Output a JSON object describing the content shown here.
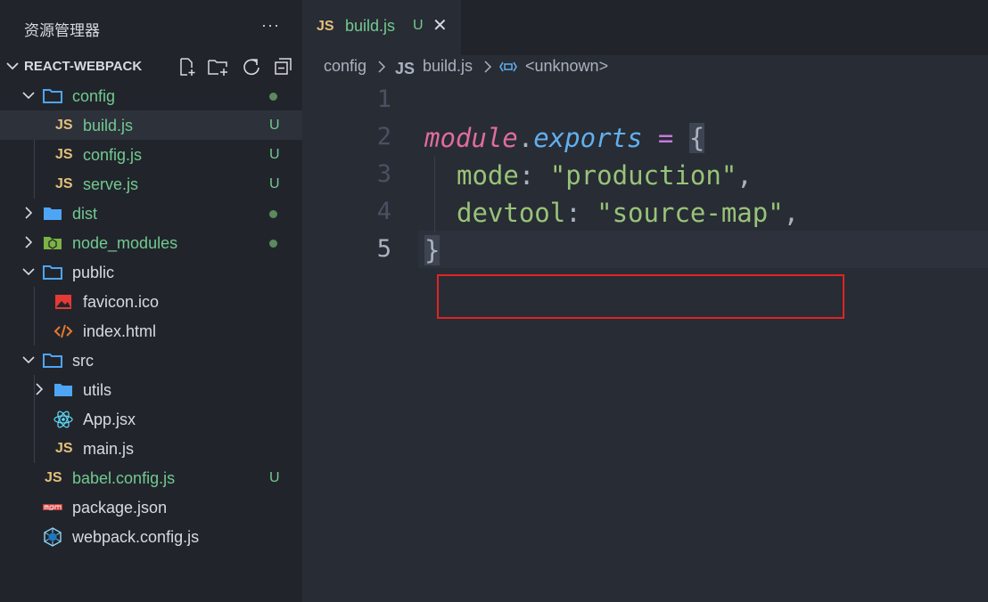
{
  "explorer": {
    "title": "资源管理器",
    "more": "···",
    "project": "REACT-WEBPACK",
    "actions": [
      "new-file-icon",
      "new-folder-icon",
      "refresh-icon",
      "collapse-all-icon"
    ],
    "tree": [
      {
        "label": "config",
        "type": "folder",
        "expanded": true,
        "badge": "dot"
      },
      {
        "label": "build.js",
        "type": "js",
        "badge": "U",
        "selected": true
      },
      {
        "label": "config.js",
        "type": "js",
        "badge": "U"
      },
      {
        "label": "serve.js",
        "type": "js",
        "badge": "U"
      },
      {
        "label": "dist",
        "type": "folder",
        "expanded": false,
        "badge": "dot"
      },
      {
        "label": "node_modules",
        "type": "folder-node",
        "expanded": false,
        "badge": "dot"
      },
      {
        "label": "public",
        "type": "folder",
        "expanded": true
      },
      {
        "label": "favicon.ico",
        "type": "image"
      },
      {
        "label": "index.html",
        "type": "html"
      },
      {
        "label": "src",
        "type": "folder",
        "expanded": true
      },
      {
        "label": "utils",
        "type": "folder",
        "expanded": false
      },
      {
        "label": "App.jsx",
        "type": "react"
      },
      {
        "label": "main.js",
        "type": "js"
      },
      {
        "label": "babel.config.js",
        "type": "js",
        "badge": "U"
      },
      {
        "label": "package.json",
        "type": "npm"
      },
      {
        "label": "webpack.config.js",
        "type": "webpack"
      }
    ]
  },
  "tab": {
    "icon": "JS",
    "label": "build.js",
    "badge": "U",
    "close": "✕"
  },
  "breadcrumb": {
    "folder": "config",
    "file_icon": "JS",
    "file": "build.js",
    "symbol": "<unknown>"
  },
  "code": {
    "line_numbers": [
      "1",
      "2",
      "3",
      "4",
      "5"
    ],
    "line2": {
      "kw": "module",
      "dot": ".",
      "prop": "exports",
      "op": " = ",
      "brace": "{"
    },
    "line3": {
      "key": "mode",
      "colon": ": ",
      "str": "\"production\"",
      "comma": ","
    },
    "line4": {
      "key": "devtool",
      "colon": ": ",
      "str": "\"source-map\"",
      "comma": ","
    },
    "line5": {
      "brace": "}"
    }
  },
  "colors": {
    "accent_highlight": "#e02424",
    "untracked": "#73c991",
    "folder": "#4fa5f5"
  }
}
